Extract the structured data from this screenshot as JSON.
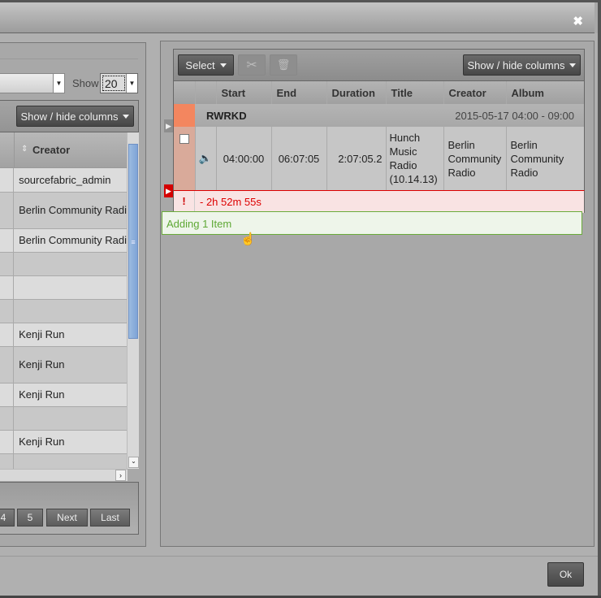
{
  "dialog": {
    "close_icon": "close-icon",
    "ok_label": "Ok"
  },
  "library": {
    "show_label": "Show",
    "show_value": "20",
    "show_hide_label": "Show / hide columns",
    "creator_header": "Creator",
    "rows": [
      {
        "creator": "sourcefabric_admin"
      },
      {
        "creator": "Berlin Community Radi"
      },
      {
        "creator": "Berlin Community Radi"
      },
      {
        "creator": ""
      },
      {
        "creator": ""
      },
      {
        "creator": ""
      },
      {
        "creator": "Kenji Run"
      },
      {
        "creator": "Kenji Run"
      },
      {
        "creator": "Kenji Run"
      },
      {
        "creator": ""
      },
      {
        "creator": "Kenji Run"
      },
      {
        "creator": ""
      }
    ],
    "pagination": {
      "page4": "4",
      "page5": "5",
      "next": "Next",
      "last": "Last"
    }
  },
  "schedule": {
    "select_label": "Select",
    "show_hide_label": "Show / hide columns",
    "headers": [
      "Start",
      "End",
      "Duration",
      "Title",
      "Creator",
      "Album"
    ],
    "show": {
      "name": "RWRKD",
      "time": "2015-05-17 04:00 - 09:00",
      "color": "#f3865f"
    },
    "item": {
      "start": "04:00:00",
      "end": "06:07:05",
      "duration": "2:07:05.2",
      "title": "Hunch Music Radio (10.14.13)",
      "creator": "Berlin Community Radio",
      "album": "Berlin Community Radio"
    },
    "gap": {
      "icon": "!",
      "text": "- 2h 52m 55s"
    },
    "drag_helper": "Adding 1 Item"
  }
}
